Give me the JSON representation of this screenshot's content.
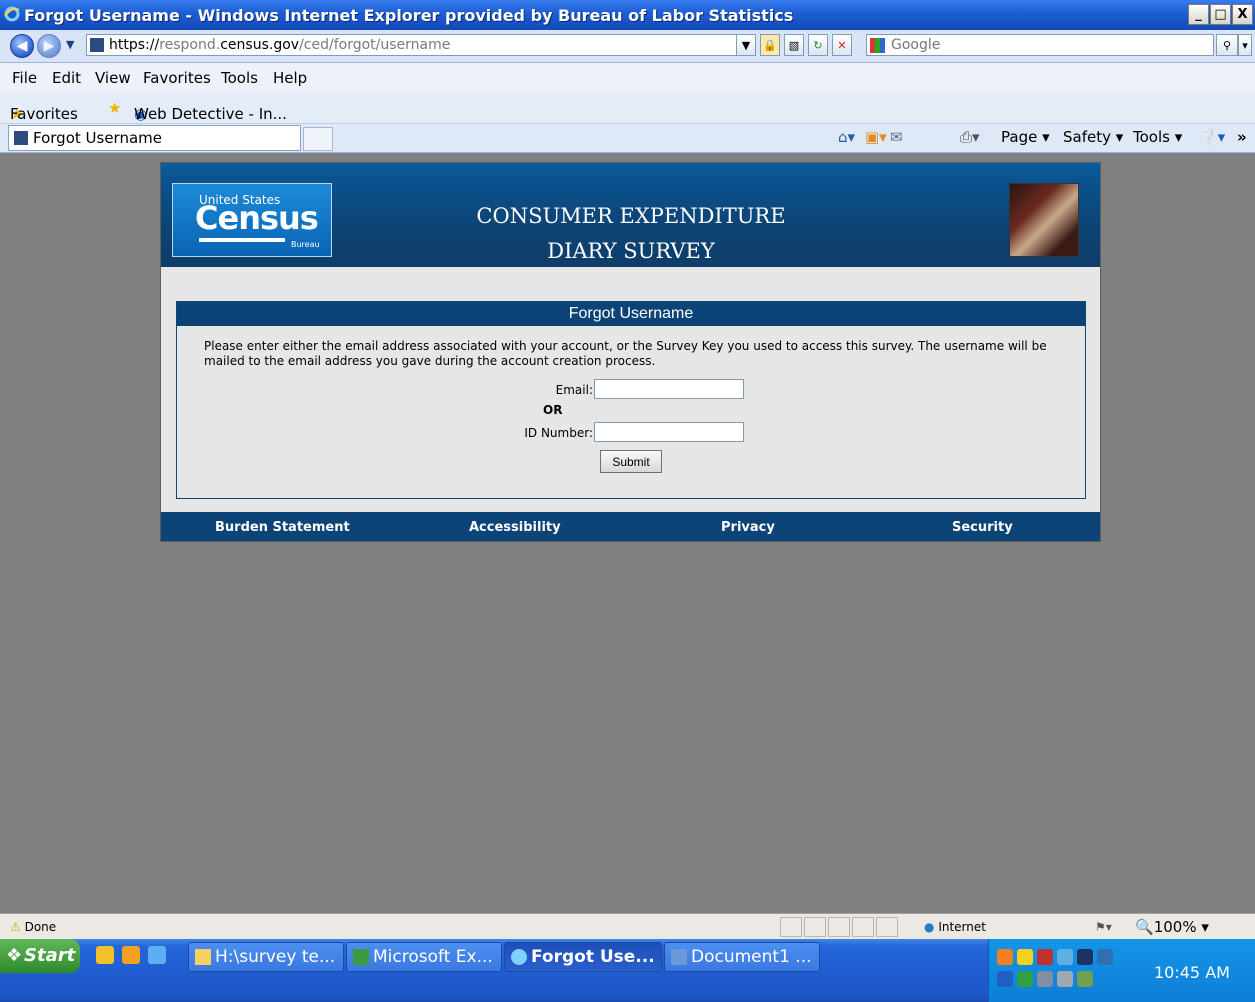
{
  "window": {
    "title": "Forgot Username - Windows Internet Explorer provided by Bureau of Labor Statistics",
    "buttons": {
      "minimize": "_",
      "maximize": "□",
      "close": "X"
    }
  },
  "address": {
    "scheme": "https://",
    "host_prefix": "respond.",
    "host": "census.gov",
    "path": "/ced/forgot/username",
    "search_placeholder": "Google"
  },
  "menu": [
    "File",
    "Edit",
    "View",
    "Favorites",
    "Tools",
    "Help"
  ],
  "favorites": {
    "label": "Favorites",
    "items": [
      "Web Detective - In..."
    ]
  },
  "tab": {
    "title": "Forgot Username"
  },
  "commandbar": [
    "Page ▾",
    "Safety ▾",
    "Tools ▾",
    "»"
  ],
  "page": {
    "banner_line1": "CONSUMER EXPENDITURE",
    "banner_line2": "DIARY SURVEY",
    "logo_us": "United States",
    "logo_census": "Census",
    "logo_bureau": "Bureau",
    "form": {
      "heading": "Forgot Username",
      "instructions": "Please enter either the email address associated with your account, or the Survey Key you used to access this survey. The username will be mailed to the email address you gave during the account creation process.",
      "email_label": "Email:",
      "or_label": "OR",
      "id_label": "ID Number:",
      "email_value": "",
      "id_value": "",
      "submit_label": "Submit"
    },
    "footer": [
      "Burden Statement",
      "Accessibility",
      "Privacy",
      "Security"
    ]
  },
  "status": {
    "text": "Done",
    "zone": "Internet",
    "zoom": "100%"
  },
  "taskbar": {
    "start": "Start",
    "tasks": [
      "H:\\survey te...",
      "Microsoft Ex...",
      "Forgot Use...",
      "Document1 ..."
    ],
    "clock": "10:45 AM"
  },
  "colors": {
    "banner": "#0d4477",
    "title_bar": "#1e5fd6",
    "taskbar": "#1d55c8"
  }
}
